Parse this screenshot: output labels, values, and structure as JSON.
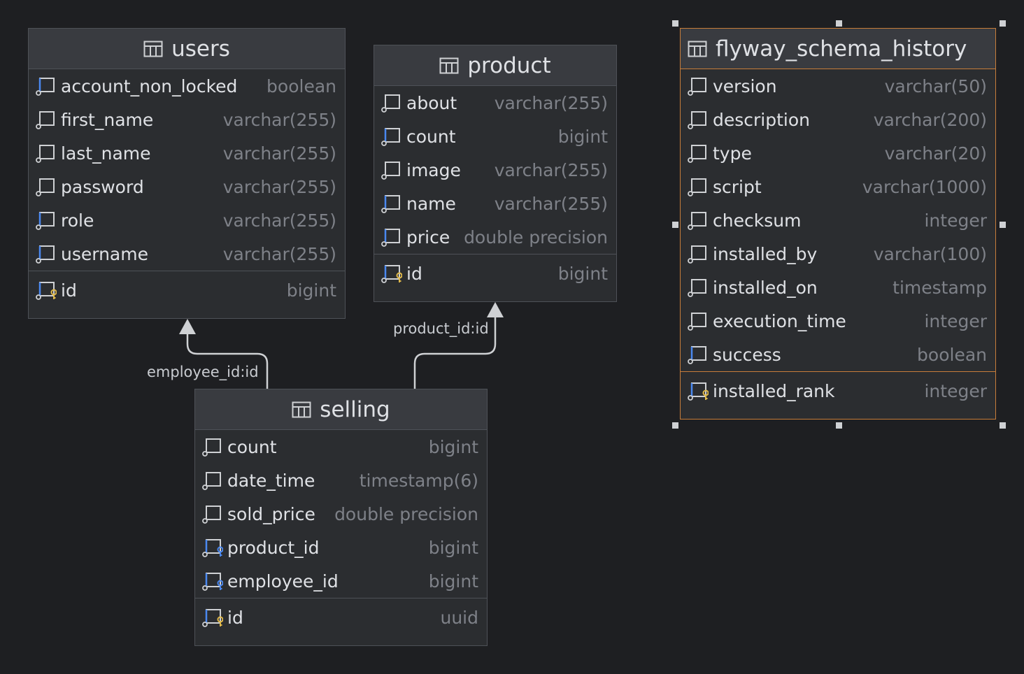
{
  "tables": {
    "users": {
      "name": "users",
      "columns": [
        {
          "name": "account_non_locked",
          "type": "boolean",
          "icon": "column-notnull-icon"
        },
        {
          "name": "first_name",
          "type": "varchar(255)",
          "icon": "column-icon"
        },
        {
          "name": "last_name",
          "type": "varchar(255)",
          "icon": "column-icon"
        },
        {
          "name": "password",
          "type": "varchar(255)",
          "icon": "column-icon"
        },
        {
          "name": "role",
          "type": "varchar(255)",
          "icon": "column-notnull-icon"
        },
        {
          "name": "username",
          "type": "varchar(255)",
          "icon": "column-notnull-icon"
        }
      ],
      "pk": {
        "name": "id",
        "type": "bigint",
        "icon": "primary-key-icon"
      }
    },
    "product": {
      "name": "product",
      "columns": [
        {
          "name": "about",
          "type": "varchar(255)",
          "icon": "column-icon"
        },
        {
          "name": "count",
          "type": "bigint",
          "icon": "column-notnull-icon"
        },
        {
          "name": "image",
          "type": "varchar(255)",
          "icon": "column-icon"
        },
        {
          "name": "name",
          "type": "varchar(255)",
          "icon": "column-notnull-icon"
        },
        {
          "name": "price",
          "type": "double precision",
          "icon": "column-notnull-icon"
        }
      ],
      "pk": {
        "name": "id",
        "type": "bigint",
        "icon": "primary-key-icon"
      }
    },
    "flyway": {
      "name": "flyway_schema_history",
      "columns": [
        {
          "name": "version",
          "type": "varchar(50)",
          "icon": "column-icon"
        },
        {
          "name": "description",
          "type": "varchar(200)",
          "icon": "column-icon"
        },
        {
          "name": "type",
          "type": "varchar(20)",
          "icon": "column-icon"
        },
        {
          "name": "script",
          "type": "varchar(1000)",
          "icon": "column-icon"
        },
        {
          "name": "checksum",
          "type": "integer",
          "icon": "column-icon"
        },
        {
          "name": "installed_by",
          "type": "varchar(100)",
          "icon": "column-icon"
        },
        {
          "name": "installed_on",
          "type": "timestamp",
          "icon": "column-icon"
        },
        {
          "name": "execution_time",
          "type": "integer",
          "icon": "column-icon"
        },
        {
          "name": "success",
          "type": "boolean",
          "icon": "column-notnull-icon"
        }
      ],
      "pk": {
        "name": "installed_rank",
        "type": "integer",
        "icon": "primary-key-icon"
      }
    },
    "selling": {
      "name": "selling",
      "columns": [
        {
          "name": "count",
          "type": "bigint",
          "icon": "column-icon"
        },
        {
          "name": "date_time",
          "type": "timestamp(6)",
          "icon": "column-icon"
        },
        {
          "name": "sold_price",
          "type": "double precision",
          "icon": "column-icon"
        },
        {
          "name": "product_id",
          "type": "bigint",
          "icon": "foreign-key-icon"
        },
        {
          "name": "employee_id",
          "type": "bigint",
          "icon": "foreign-key-icon"
        }
      ],
      "pk": {
        "name": "id",
        "type": "uuid",
        "icon": "primary-key-icon"
      }
    }
  },
  "relations": {
    "employee": "employee_id:id",
    "product": "product_id:id"
  },
  "colors": {
    "background": "#1e1f22",
    "table_bg": "#2b2d30",
    "header_bg": "#393b40",
    "border": "#4e5157",
    "selected_border": "#c77d3a",
    "text": "#dfe1e5",
    "type_text": "#7e8188",
    "key_color": "#e0b94a",
    "notnull_color": "#4a88f0"
  }
}
